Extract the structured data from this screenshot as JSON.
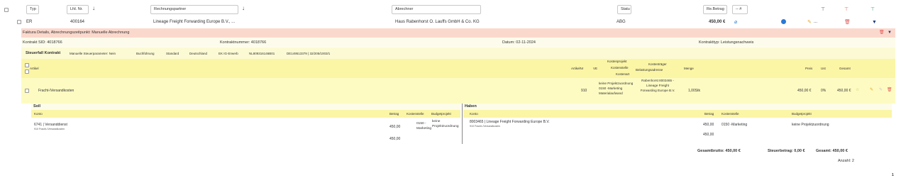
{
  "filters": {
    "typ": "Typ",
    "lfd_nr": "Lfd. Nr.",
    "rechnungspartner": "Rechnungspartner",
    "abrechner": "Abrechner",
    "status": "Statu",
    "rebetrag": "Re.Betrag",
    "dropdown": "-- #"
  },
  "row": {
    "typ": "ER",
    "lfd_nr": "400164",
    "partner": "Lineage Freight Forwarding Europe B.V., ...",
    "abrechner": "Haus Rabenhorst O. Lauffs GmbH & Co. KG",
    "status": "ABG",
    "betrag": "450,00 €",
    "ellipsis": "..."
  },
  "faktura_header": "Faktura Details, Abrechnungszeitpunkt: Manuelle Abrechnung",
  "kontrakt": {
    "sid": "Kontrakt SID: 4018766",
    "nummer": "Kontraktnummer: 4018766",
    "datum": "Datum: 02-11-2024",
    "typ": "Kontrakttyp: Leistungsnachweis"
  },
  "steuerfall": {
    "label": "Steuerfall Kontrakt",
    "manuelle": "Manuelle Steuerparameter: Nein",
    "buchfuehrung": "Buchführung",
    "standard": "Standard",
    "land": "Deutschland",
    "erwerb": "EK IG-Erwerb",
    "nl_id": "NL809316146B01",
    "de_id": "DE149513379 | 32/205/1003/1"
  },
  "artikel_headers": {
    "artikel": "Artikel",
    "artikelnr": "ArtikelNr",
    "ve": "VE",
    "kostenprojekt": "Kostenprojekt",
    "kostenstelle": "Kostenstelle",
    "kostenart": "Kostenart",
    "kostentraeger": "Kostenträger",
    "belastungsadresse": "Belastungsadresse",
    "menge": "Menge",
    "preis": "Preis",
    "ust": "Ust",
    "gesamt": "Gesamt"
  },
  "artikel_row": {
    "name": "Fracht-/Versandkosten",
    "nr": "910",
    "kosten": "keine Projektzuordnung 0150 -Marketing Materialaufwand",
    "belastung": "Rabenhorst 8003465 - Lineage Freight Forwarding Europe B.V.",
    "menge": "1,00",
    "einheit": "Stk",
    "preis": "450,00 €",
    "ust": "0%",
    "gesamt": "450,00 €"
  },
  "soll": {
    "title": "Soll",
    "h_konto": "Konto",
    "h_betrag": "Betrag",
    "h_kostenstelle": "Kostenstelle",
    "h_budget": "Budgetprojekt",
    "konto": "6741 | Versanddienst",
    "konto_sub": "910 Fracht-/Versandkosten",
    "betrag": "450,00",
    "kostenstelle": "0150 - Marketing",
    "budget": "keine Projektzuordnung",
    "sum": "450,00"
  },
  "haben": {
    "title": "Haben",
    "h_konto": "Konto",
    "h_betrag": "Betrag",
    "h_kostenstelle": "Kostenstelle",
    "h_budget": "Budgetprojekt",
    "konto": "8003465 | Lineage Freight Forwarding Europe B.V.",
    "konto_sub": "910 Fracht-/Versandkosten",
    "betrag": "450,00",
    "kostenstelle": "0150 -Marketing",
    "budget": "keine Projektzuordnung",
    "sum": "450,00"
  },
  "totals": {
    "brutto": "Gesamtbrutto: 450,00 €",
    "steuer": "Steuerbetrag: 0,00 €",
    "gesamt": "Gesamt: 450,00 €",
    "anzahl": "Anzahl: 2"
  },
  "page_number": "1",
  "colors": {
    "header_band": "#fbd8cc",
    "yellow_band": "#fcfad4",
    "table_header": "#fbf5a6",
    "row_band": "#fdfbc2",
    "blue_icon": "#2a78d4",
    "red_icon": "#e15b5b",
    "pencil": "#e0a72a"
  },
  "icons": [
    "filter-icon",
    "filter-remove-icon",
    "filter-add-icon",
    "sort-arrow-icon",
    "attachment-icon",
    "info-icon",
    "edit-icon",
    "delete-icon",
    "expand-icon",
    "star-icon"
  ]
}
